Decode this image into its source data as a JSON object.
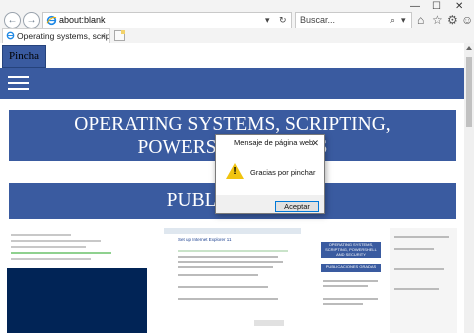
{
  "browser": {
    "url": "about:blank",
    "search_placeholder": "Buscar...",
    "tab_title": "Operating systems, scriptin...",
    "tab_close": "×",
    "back_glyph": "←",
    "forward_glyph": "→",
    "refresh_glyph": "↻",
    "search_glyph": "⌕",
    "dropdown_glyph": "▾",
    "home_glyph": "⌂",
    "star_glyph": "☆",
    "gear_glyph": "⚙",
    "smile_glyph": "☺",
    "minimize_glyph": "—",
    "maximize_glyph": "☐",
    "close_glyph": "✕"
  },
  "page": {
    "brand": "Pincha",
    "banner_title": "OPERATING SYSTEMS, SCRIPTING, POWERSHELL AND S",
    "section_title": "PUBLICACI                          AS",
    "thumbnails": [
      {
        "name": "powershell-screenshot"
      },
      {
        "name": "ie-setup-screenshot",
        "caption": "Set up Internet Explorer 11"
      },
      {
        "name": "blog-screenshot",
        "banner": "OPERATING SYSTEMS, SCRIPTING, POWERSHELL AND SECURITY",
        "subbanner": "PUBLICACIONES GRADAS"
      },
      {
        "name": "blog-sidebar"
      }
    ]
  },
  "dialog": {
    "title": "Mensaje de página web",
    "message": "Gracias por pinchar",
    "ok_label": "Aceptar",
    "close_glyph": "✕"
  },
  "colors": {
    "brand_blue": "#3a5ba0",
    "warning_yellow": "#f1c40f",
    "focus_blue": "#0078d7"
  }
}
